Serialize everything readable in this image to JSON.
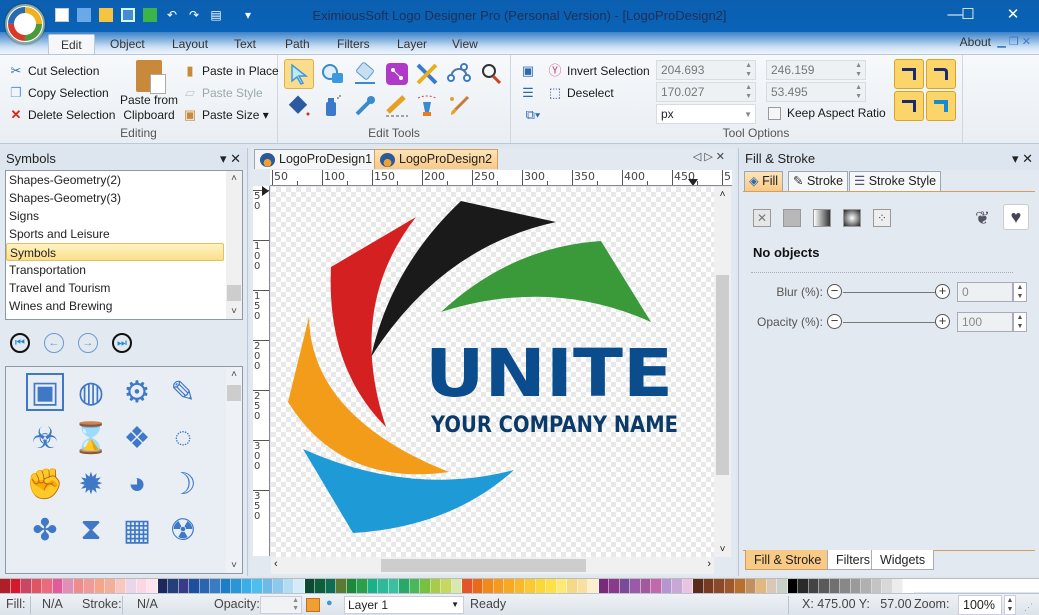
{
  "window": {
    "title": "EximiousSoft Logo Designer Pro (Personal Version) - [LogoProDesign2]",
    "minimize_label": "—",
    "maximize_label": "☐",
    "close_label": "✕"
  },
  "quick_access": [
    "new-icon",
    "new-template-icon",
    "open-folder-icon",
    "save-icon",
    "save-as-icon",
    "undo-icon",
    "redo-icon",
    "print-icon",
    "customize-dropdown-icon"
  ],
  "ribbon_tabs": [
    {
      "label": "Edit",
      "active": true
    },
    {
      "label": "Object"
    },
    {
      "label": "Layout"
    },
    {
      "label": "Text"
    },
    {
      "label": "Path"
    },
    {
      "label": "Filters"
    },
    {
      "label": "Layer"
    },
    {
      "label": "View"
    }
  ],
  "about_label": "About",
  "editing_group": {
    "label": "Editing",
    "cut": "Cut Selection",
    "copy": "Copy Selection",
    "delete": "Delete Selection",
    "paste_clipboard": "Paste from Clipboard",
    "paste_clipboard_l1": "Paste from",
    "paste_clipboard_l2": "Clipboard",
    "paste_in_place": "Paste in Place",
    "paste_style": "Paste Style",
    "paste_size": "Paste Size ▾"
  },
  "edit_tools_group": {
    "label": "Edit Tools",
    "tools": [
      "select-tool",
      "shape-tool",
      "eraser-tool",
      "node-tool",
      "pencil-ruler-tool",
      "bezier-tool",
      "zoom-tool",
      "fill-bucket-tool",
      "spray-tool",
      "eyedropper-tool",
      "pencil-tool",
      "pen-tool",
      "brush-tool"
    ],
    "selected_tool": "select-tool"
  },
  "selection_group": {
    "invert_selection": "Invert Selection",
    "deselect": "Deselect"
  },
  "tool_options": {
    "label": "Tool Options",
    "x": "204.693",
    "y": "170.027",
    "width": "246.159",
    "height": "53.495",
    "unit": "px",
    "keep_aspect_ratio": "Keep Aspect Ratio",
    "keep_aspect_checked": false
  },
  "symbols_panel": {
    "title": "Symbols",
    "categories": [
      "Shapes-Geometry(2)",
      "Shapes-Geometry(3)",
      "Signs",
      "Sports and Leisure",
      "Symbols",
      "Transportation",
      "Travel and Tourism",
      "Wines and Brewing"
    ],
    "selected_category": "Symbols",
    "nav": [
      "first-page-icon",
      "previous-page-icon",
      "next-page-icon",
      "last-page-icon"
    ],
    "symbols": [
      {
        "name": "kiss-frame-symbol",
        "glyph": "▣"
      },
      {
        "name": "mountain-circle-symbol",
        "glyph": "◍"
      },
      {
        "name": "gear-symbol",
        "glyph": "⚙"
      },
      {
        "name": "pencil-sharpener-symbol",
        "glyph": "✎"
      },
      {
        "name": "biohazard-symbol",
        "glyph": "☣"
      },
      {
        "name": "hourglass-symbol",
        "glyph": "⌛"
      },
      {
        "name": "diamond-cluster-symbol",
        "glyph": "❖"
      },
      {
        "name": "dotted-circle-symbol",
        "glyph": "◌"
      },
      {
        "name": "fist-symbol",
        "glyph": "✊"
      },
      {
        "name": "sun-symbol",
        "glyph": "✹"
      },
      {
        "name": "arrow-circle-symbol",
        "glyph": "◕"
      },
      {
        "name": "sword-symbol",
        "glyph": "☽"
      },
      {
        "name": "molecule-symbol",
        "glyph": "✤"
      },
      {
        "name": "medal-symbol",
        "glyph": "⧗"
      },
      {
        "name": "checker-symbol",
        "glyph": "▦"
      },
      {
        "name": "radiation-symbol",
        "glyph": "☢"
      }
    ]
  },
  "documents": {
    "tabs": [
      {
        "label": "LogoProDesign1",
        "active": false
      },
      {
        "label": "LogoProDesign2",
        "active": true
      }
    ],
    "ruler_h": [
      "50",
      "100",
      "150",
      "200",
      "250",
      "300",
      "350",
      "400",
      "450",
      "5"
    ],
    "ruler_v": [
      "50",
      "100",
      "150",
      "200",
      "250",
      "300",
      "350"
    ],
    "logo": {
      "title": "UNITE",
      "subtitle": "YOUR COMPANY NAME",
      "text_color": "#0a4c8c",
      "swoosh_colors": [
        "#1a1a1a",
        "#3a9a3a",
        "#d42020",
        "#f39c1a",
        "#1e9ad6"
      ]
    }
  },
  "fill_stroke_panel": {
    "title": "Fill & Stroke",
    "tabs": [
      {
        "label": "Fill",
        "active": true
      },
      {
        "label": "Stroke"
      },
      {
        "label": "Stroke Style"
      }
    ],
    "fill_modes": [
      "no-paint",
      "flat-color",
      "linear-gradient",
      "radial-gradient",
      "pattern"
    ],
    "status": "No objects",
    "blur_label": "Blur (%):",
    "blur_value": "0",
    "opacity_label": "Opacity (%):",
    "opacity_value": "100",
    "bottom_tabs": [
      {
        "label": "Fill & Stroke",
        "active": true
      },
      {
        "label": "Filters"
      },
      {
        "label": "Widgets"
      }
    ]
  },
  "palette": [
    "#b01e2a",
    "#d4192f",
    "#c94763",
    "#e05564",
    "#ea6b7e",
    "#e25a9a",
    "#e18fb5",
    "#ef8d8d",
    "#f19a9a",
    "#f5a68a",
    "#f2b09c",
    "#f8c7c0",
    "#e9d6ea",
    "#fad7e2",
    "#ffe4ee",
    "#1b2a5a",
    "#24407a",
    "#3a3a8a",
    "#1e4f9c",
    "#2a66b0",
    "#3a7cc4",
    "#1c7ec8",
    "#2b96d6",
    "#3aaee6",
    "#4dbfee",
    "#6fb8e8",
    "#8ec8ea",
    "#b4dcf2",
    "#d5ebf7",
    "#0c4a34",
    "#0d5e3a",
    "#0f6e52",
    "#5a7a32",
    "#1a8a3a",
    "#2aa04a",
    "#1ab08a",
    "#30b89a",
    "#3ac0a0",
    "#2aa86a",
    "#4ab85a",
    "#7ac040",
    "#a8cc4a",
    "#c6d860",
    "#d8e8b0",
    "#e2562a",
    "#ea6a1a",
    "#f08a1a",
    "#f49a20",
    "#f6aa22",
    "#f8b82a",
    "#f9c832",
    "#fbd83a",
    "#fde04a",
    "#fde878",
    "#f5d888",
    "#f8e0a0",
    "#fcefd0",
    "#7a2a7a",
    "#8a3a8a",
    "#7a4a9a",
    "#9a5aa8",
    "#a25a9a",
    "#c06aaa",
    "#b496d0",
    "#caa8d6",
    "#e8c4e0",
    "#5a2a1a",
    "#7a3a22",
    "#8a4a2a",
    "#a0582a",
    "#b87030",
    "#c09060",
    "#e0b880",
    "#d8c8b8",
    "#c8d0c8",
    "#000000",
    "#2a2a2a",
    "#444444",
    "#5a5a5a",
    "#707070",
    "#888888",
    "#9a9a9a",
    "#b0b0b0",
    "#c4c4c4",
    "#d8d8d8",
    "#ececec",
    "#ffffff"
  ],
  "statusbar": {
    "fill_label": "Fill:",
    "fill_value": "N/A",
    "stroke_label": "Stroke:",
    "stroke_value": "N/A",
    "opacity_label": "Opacity:",
    "opacity_value": "",
    "layer": "Layer 1",
    "status": "Ready",
    "coords": "X: 475.00 Y:   57.00",
    "zoom_label": "Zoom:",
    "zoom_value": "100%"
  }
}
